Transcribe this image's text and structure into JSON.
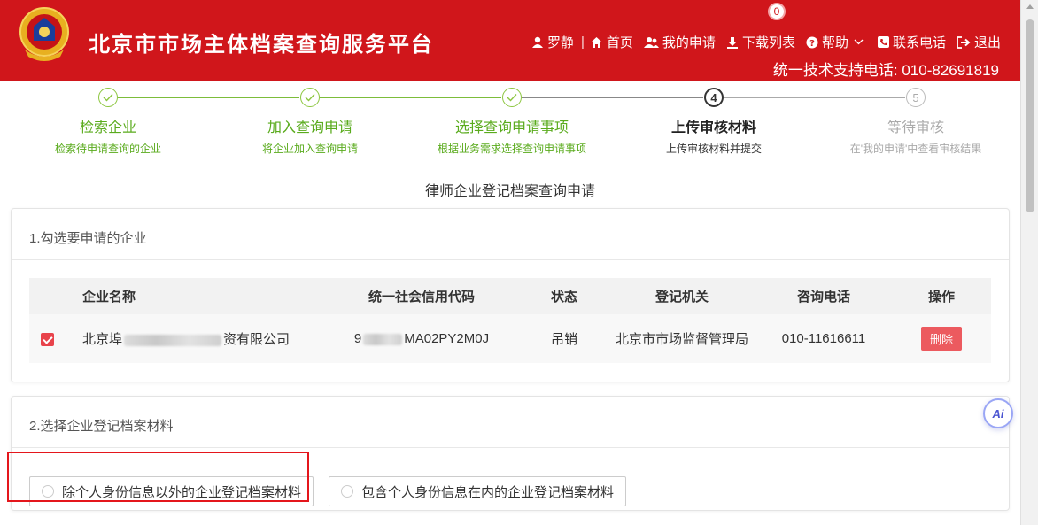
{
  "header": {
    "title": "北京市市场主体档案查询服务平台",
    "user": "罗静",
    "nav": {
      "home": "首页",
      "my_applications": "我的申请",
      "download_list": "下载列表",
      "download_count": "0",
      "help": "帮助",
      "contact": "联系电话",
      "logout": "退出"
    },
    "support_phone": "统一技术支持电话: 010-82691819"
  },
  "steps": [
    {
      "num": "✓",
      "title": "检索企业",
      "sub": "检索待申请查询的企业",
      "state": "done"
    },
    {
      "num": "✓",
      "title": "加入查询申请",
      "sub": "将企业加入查询申请",
      "state": "done"
    },
    {
      "num": "✓",
      "title": "选择查询申请事项",
      "sub": "根据业务需求选择查询申请事项",
      "state": "done"
    },
    {
      "num": "4",
      "title": "上传审核材料",
      "sub": "上传审核材料并提交",
      "state": "current"
    },
    {
      "num": "5",
      "title": "等待审核",
      "sub": "在'我的申请'中查看审核结果",
      "state": "pending"
    }
  ],
  "form_title": "律师企业登记档案查询申请",
  "section1": {
    "title": "1.勾选要申请的企业",
    "columns": [
      "企业名称",
      "统一社会信用代码",
      "状态",
      "登记机关",
      "咨询电话",
      "操作"
    ],
    "row": {
      "name_prefix": "北京埠",
      "name_suffix": "资有限公司",
      "code_prefix": "9",
      "code_suffix": "MA02PY2M0J",
      "status": "吊销",
      "authority": "北京市市场监督管理局",
      "phone": "010-11616611",
      "action": "删除"
    }
  },
  "section2": {
    "title": "2.选择企业登记档案材料",
    "option1": "除个人身份信息以外的企业登记档案材料",
    "option2": "包含个人身份信息在内的企业登记档案材料"
  },
  "ai_label": "Ai",
  "colors": {
    "brand_red": "#d0161b",
    "done_green": "#5aab1d",
    "delete_red": "#ec5a5f"
  }
}
